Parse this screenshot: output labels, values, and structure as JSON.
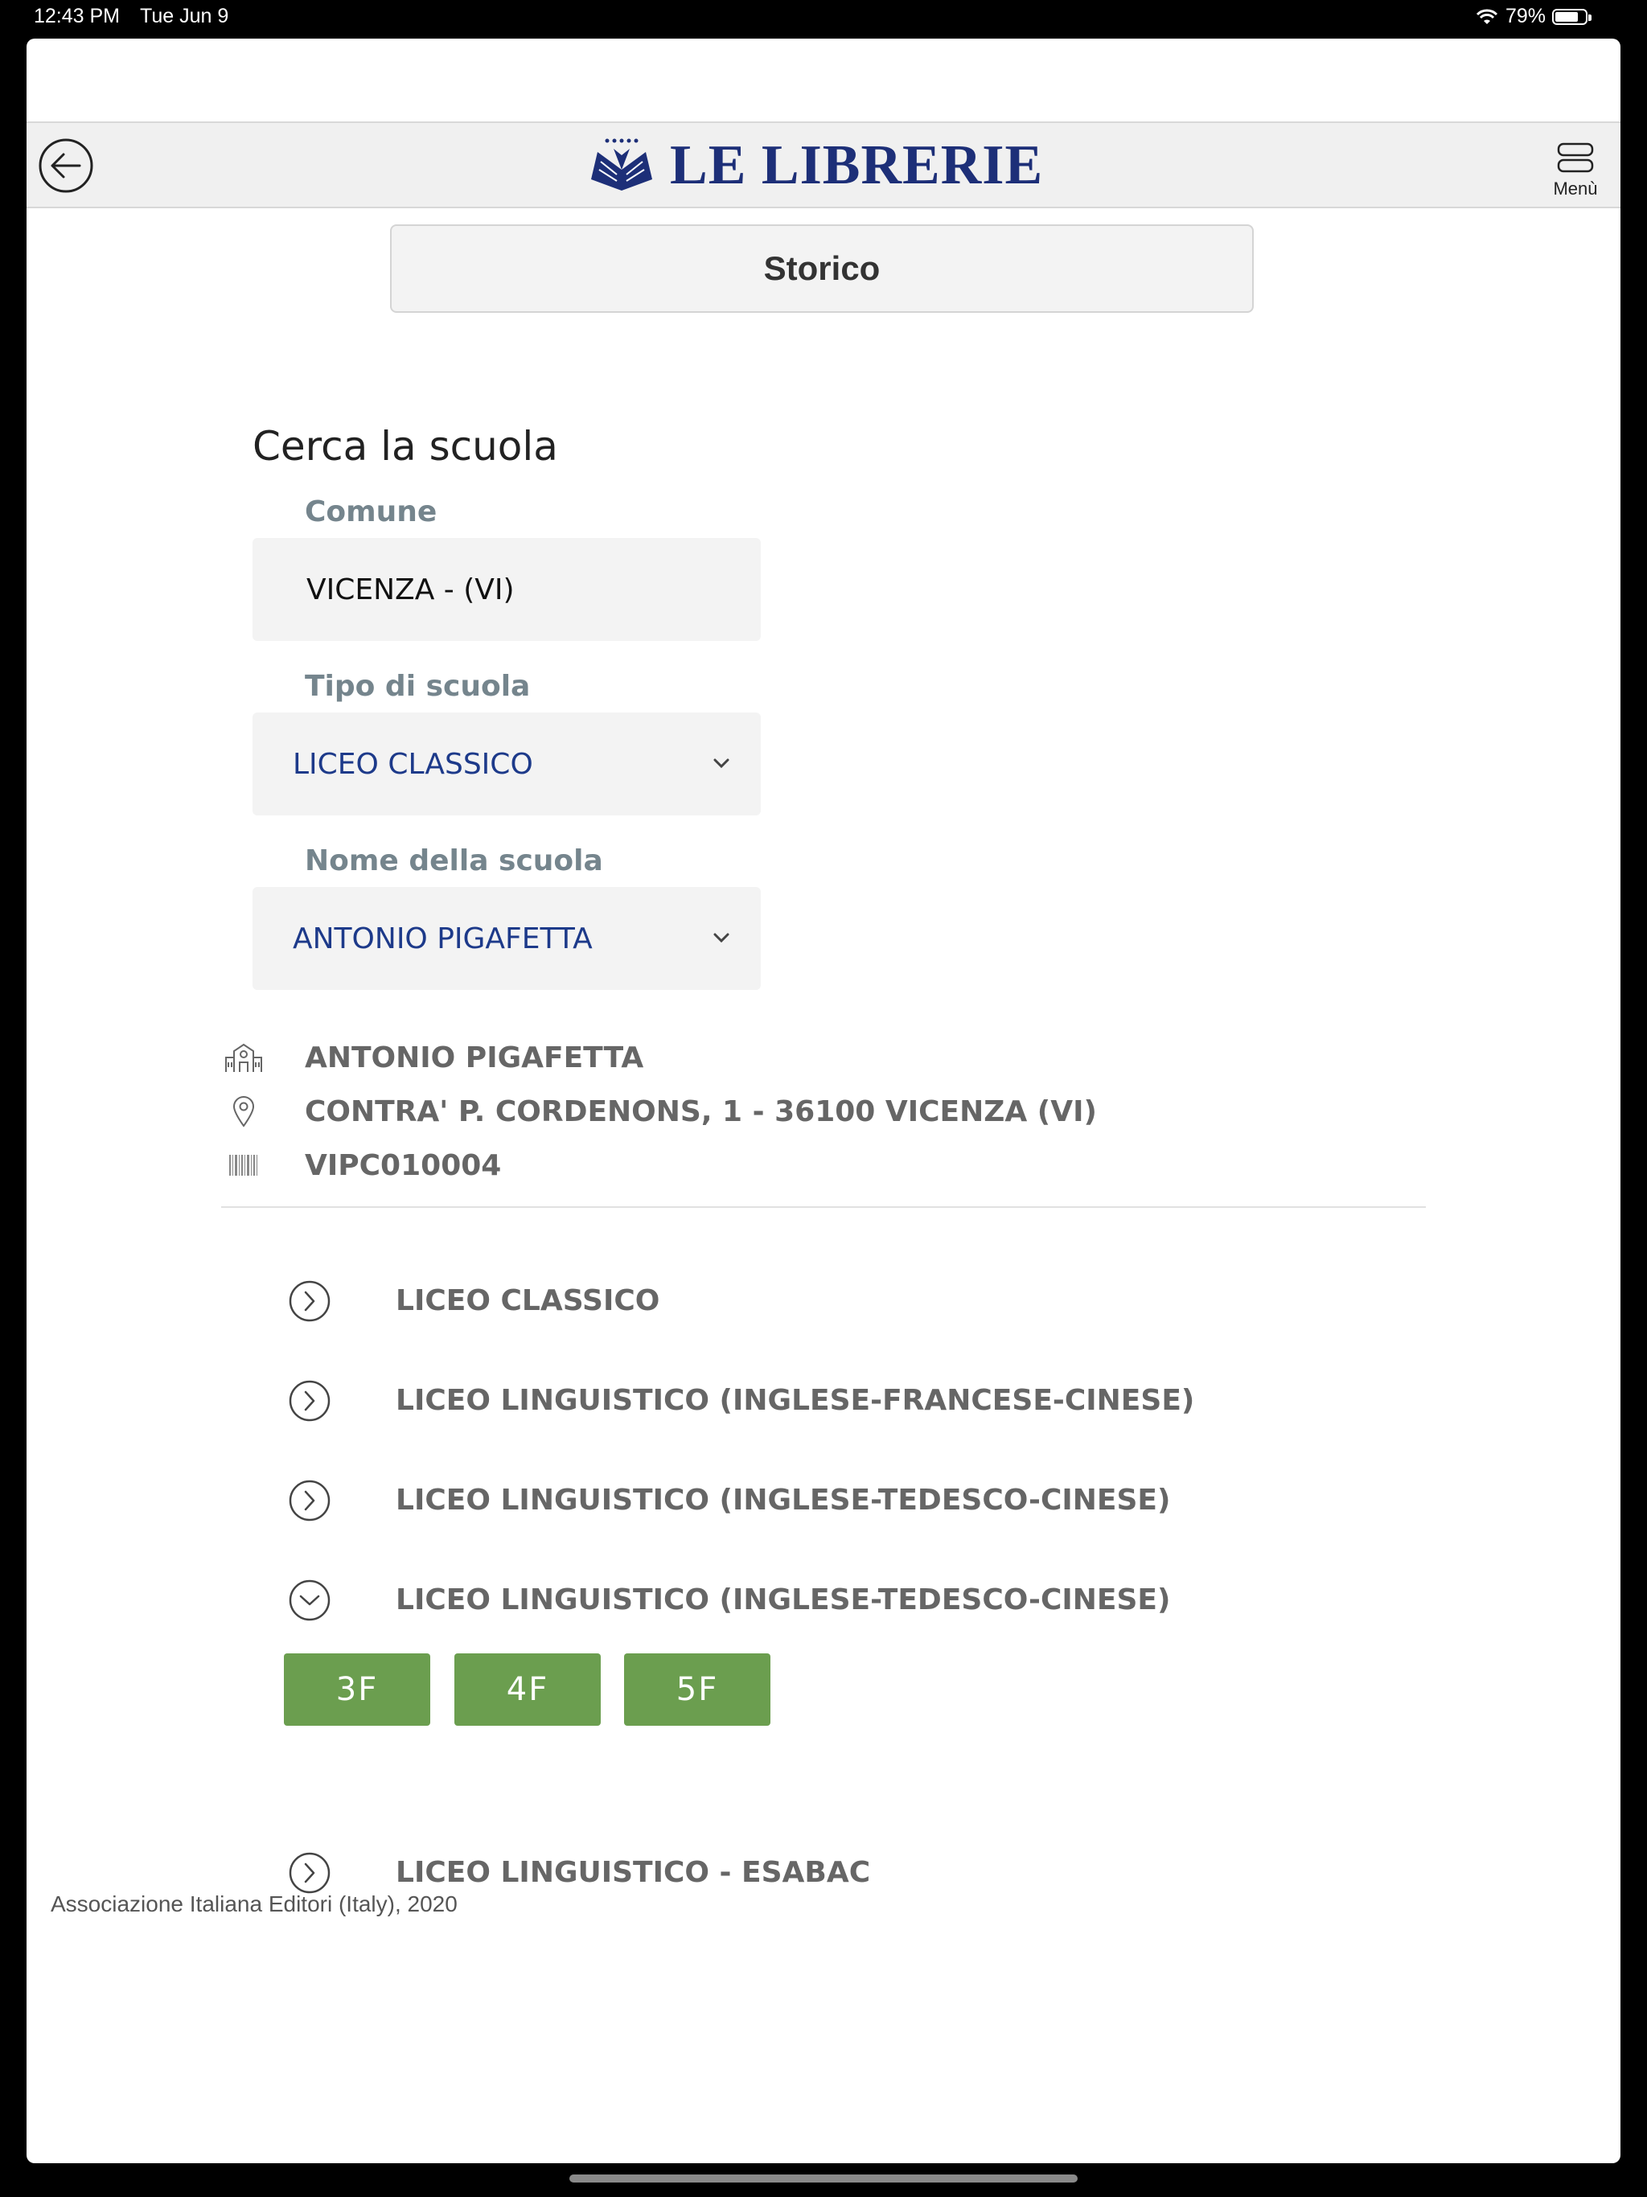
{
  "status_bar": {
    "time": "12:43 PM",
    "date": "Tue Jun 9",
    "battery": "79%",
    "battery_level": 0.79
  },
  "header": {
    "logo_text": "LE LIBRERIE",
    "menu_label": "Menù"
  },
  "storico_label": "Storico",
  "search": {
    "title": "Cerca la scuola",
    "comune_label": "Comune",
    "comune_value": "VICENZA - (VI)",
    "tipo_label": "Tipo di scuola",
    "tipo_value": "LICEO CLASSICO",
    "nome_label": "Nome della scuola",
    "nome_value": "ANTONIO PIGAFETTA"
  },
  "school": {
    "name": "ANTONIO PIGAFETTA",
    "address": "CONTRA' P. CORDENONS, 1 - 36100 VICENZA (VI)",
    "code": "VIPC010004"
  },
  "courses": [
    {
      "label": "LICEO CLASSICO",
      "expanded": false
    },
    {
      "label": "LICEO LINGUISTICO (INGLESE-FRANCESE-CINESE)",
      "expanded": false
    },
    {
      "label": "LICEO LINGUISTICO (INGLESE-TEDESCO-CINESE)",
      "expanded": false
    },
    {
      "label": "LICEO LINGUISTICO (INGLESE-TEDESCO-CINESE)",
      "expanded": true
    },
    {
      "label": "LICEO LINGUISTICO - ESABAC",
      "expanded": false
    }
  ],
  "classes": [
    "3F",
    "4F",
    "5F"
  ],
  "footer": "Associazione Italiana Editori (Italy), 2020",
  "colors": {
    "brand_blue": "#1d2f78",
    "class_green": "#6b9e4f",
    "label_gray": "#75858d"
  }
}
